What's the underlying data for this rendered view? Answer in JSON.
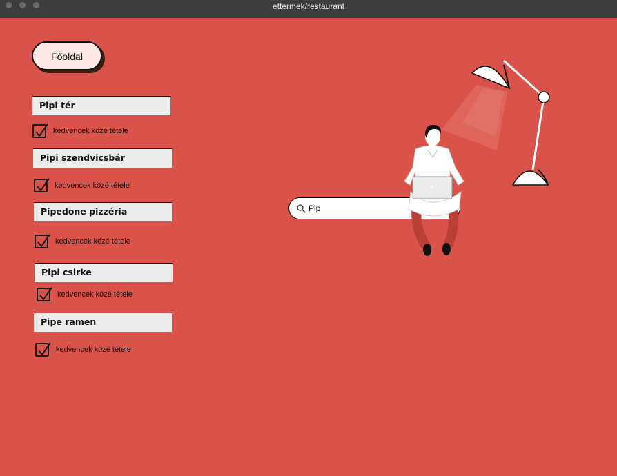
{
  "window": {
    "title": "ettermek/restaurant"
  },
  "nav": {
    "home_label": "Főoldal"
  },
  "restaurants": [
    {
      "name": "Pipi tér",
      "favorite_label": "kedvencek közé tétele",
      "checked": true
    },
    {
      "name": "Pipi szendvicsbár",
      "favorite_label": "kedvencek közé tétele",
      "checked": true
    },
    {
      "name": "Pipedone pizzéria",
      "favorite_label": "kedvencek közé tétele",
      "checked": true
    },
    {
      "name": "Pipi csirke",
      "favorite_label": "kedvencek közé tétele",
      "checked": true
    },
    {
      "name": "Pipe ramen",
      "favorite_label": "kedvencek közé tétele",
      "checked": true
    }
  ],
  "search": {
    "value": "Pip",
    "icon": "search-icon"
  },
  "colors": {
    "background": "#d9534a",
    "titlebar": "#3d3d3d",
    "home_button": "#fde8e6",
    "card": "#ececec"
  }
}
